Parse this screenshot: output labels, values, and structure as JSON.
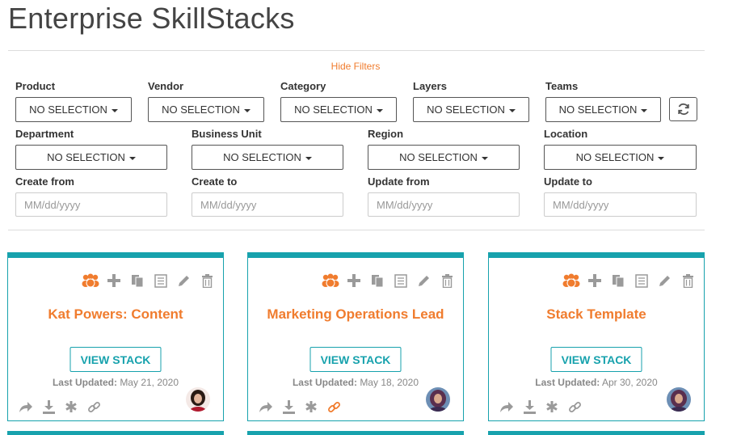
{
  "page": {
    "title": "Enterprise SkillStacks"
  },
  "filters": {
    "hide_label": "Hide Filters",
    "dropdowns": [
      {
        "label": "Product",
        "value": "NO SELECTION"
      },
      {
        "label": "Vendor",
        "value": "NO SELECTION"
      },
      {
        "label": "Category",
        "value": "NO SELECTION"
      },
      {
        "label": "Layers",
        "value": "NO SELECTION"
      },
      {
        "label": "Teams",
        "value": "NO SELECTION"
      },
      {
        "label": "Department",
        "value": "NO SELECTION"
      },
      {
        "label": "Business Unit",
        "value": "NO SELECTION"
      },
      {
        "label": "Region",
        "value": "NO SELECTION"
      },
      {
        "label": "Location",
        "value": "NO SELECTION"
      }
    ],
    "dates": [
      {
        "label": "Create from",
        "placeholder": "MM/dd/yyyy",
        "value": ""
      },
      {
        "label": "Create to",
        "placeholder": "MM/dd/yyyy",
        "value": ""
      },
      {
        "label": "Update from",
        "placeholder": "MM/dd/yyyy",
        "value": ""
      },
      {
        "label": "Update to",
        "placeholder": "MM/dd/yyyy",
        "value": ""
      }
    ],
    "refresh_icon": "refresh-icon"
  },
  "colors": {
    "accent_teal": "#17a2ad",
    "accent_orange": "#f07c2e",
    "icon_gray": "#9a9a9a"
  },
  "cards": [
    {
      "title": "Kat Powers: Content",
      "button": "VIEW STACK",
      "updated_label": "Last Updated:",
      "updated_date": "May 21, 2020",
      "link_active": false
    },
    {
      "title": "Marketing Operations Lead",
      "button": "VIEW STACK",
      "updated_label": "Last Updated:",
      "updated_date": "May 18, 2020",
      "link_active": true
    },
    {
      "title": "Stack Template",
      "button": "VIEW STACK",
      "updated_label": "Last Updated:",
      "updated_date": "Apr 30, 2020",
      "link_active": false
    }
  ],
  "card_tool_icons": [
    "team-icon",
    "plus-icon",
    "copy-icon",
    "list-icon",
    "pencil-icon",
    "trash-icon"
  ],
  "card_action_icons": [
    "share-icon",
    "download-icon",
    "asterisk-icon",
    "link-icon"
  ]
}
